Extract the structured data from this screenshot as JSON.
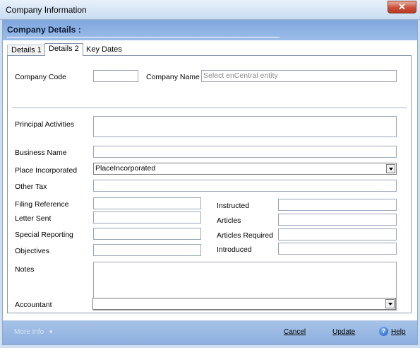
{
  "window": {
    "title": "Company Information",
    "close_glyph": "✕"
  },
  "header": {
    "title": "Company Details  :"
  },
  "tabs": [
    {
      "label": "Details 1"
    },
    {
      "label": "Details 2"
    },
    {
      "label": "Key Dates"
    }
  ],
  "form": {
    "company_code": {
      "label": "Company Code",
      "value": ""
    },
    "company_name": {
      "label": "Company Name",
      "placeholder": "Select enCentral entity"
    },
    "principal_activities": {
      "label": "Principal Activities",
      "value": ""
    },
    "business_name": {
      "label": "Business Name",
      "value": ""
    },
    "place_incorporated": {
      "label": "Place Incorporated",
      "value": "PlaceIncorporated"
    },
    "other_tax": {
      "label": "Other Tax",
      "value": ""
    },
    "filing_reference": {
      "label": "Filing Reference",
      "value": ""
    },
    "letter_sent": {
      "label": "Letter Sent",
      "value": ""
    },
    "special_reporting": {
      "label": "Special Reporting",
      "value": ""
    },
    "objectives": {
      "label": "Objectives",
      "value": ""
    },
    "instructed": {
      "label": "Instructed",
      "value": ""
    },
    "articles": {
      "label": "Articles",
      "value": ""
    },
    "articles_required": {
      "label": "Articles Required",
      "value": ""
    },
    "introduced": {
      "label": "Introduced",
      "value": ""
    },
    "notes": {
      "label": "Notes",
      "value": ""
    },
    "accountant": {
      "label": "Accountant",
      "value": ""
    }
  },
  "footer": {
    "more_info": "More Info",
    "cancel": "Cancel",
    "update": "Update",
    "help": "Help"
  },
  "colors": {
    "header": "#8fb3e6",
    "footer": "#9bbbe3",
    "close": "#c9503a"
  },
  "icons": [
    "close-icon",
    "chevron-down-icon",
    "help-icon"
  ]
}
